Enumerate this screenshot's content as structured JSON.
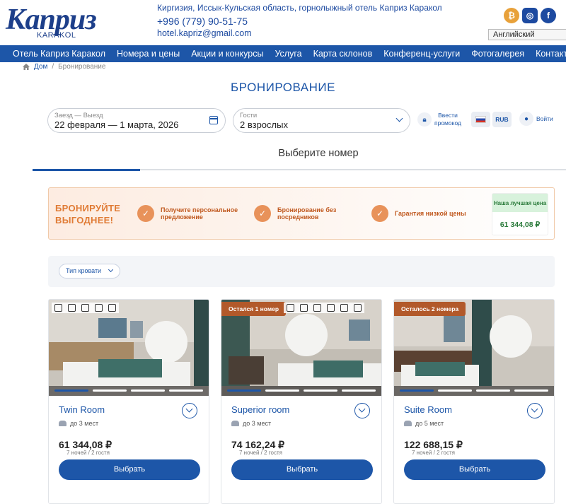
{
  "header": {
    "logo_text": "Каприз",
    "logo_sub": "KARAKOL",
    "address": "Киргизия, Иссык-Кульская область, горнолыжный отель Каприз Каракол",
    "phone": "+996 (779) 90-51-75",
    "email": "hotel.kapriz@gmail.com",
    "socials": [
      {
        "icon": "bitcoin-icon",
        "glyph": "₿"
      },
      {
        "icon": "instagram-icon",
        "glyph": "◎"
      },
      {
        "icon": "facebook-icon",
        "glyph": "f"
      }
    ],
    "language": "Английский"
  },
  "nav": [
    "Отель Каприз Каракол",
    "Номера и цены",
    "Акции и конкурсы",
    "Услуга",
    "Карта склонов",
    "Конференц-услуги",
    "Фотогалерея",
    "Контакты"
  ],
  "breadcrumb": {
    "home": "Дом",
    "current": "Бронирование"
  },
  "page_title": "БРОНИРОВАНИЕ",
  "search": {
    "dates_label": "Заезд — Выезд",
    "dates_value": "22 февраля — 1 марта, 2026",
    "guests_label": "Гости",
    "guests_value": "2 взрослых"
  },
  "account": {
    "promo_line1": "Ввести",
    "promo_line2": "промокод",
    "currency": "RUB",
    "login": "Войти"
  },
  "step_title": "Выберите номер",
  "promo": {
    "head_line1": "БРОНИРУЙТЕ",
    "head_line2": "ВЫГОДНЕЕ!",
    "perks": [
      {
        "line1": "Получите персональное",
        "line2": "предложение"
      },
      {
        "line1": "Бронирование без",
        "line2": "посредников"
      },
      {
        "line1": "Гарантия низкой цены",
        "line2": ""
      }
    ],
    "best_label": "Наша лучшая цена",
    "best_price": "61 344,08 ₽"
  },
  "filter": {
    "bed_type": "Тип кровати"
  },
  "rooms": [
    {
      "name": "Twin Room",
      "badge": "",
      "capacity": "до 3 мест",
      "price": "61 344,08 ₽",
      "nights": "7 ночей / 2 гостя",
      "button": "Выбрать"
    },
    {
      "name": "Superior room",
      "badge": "Остался 1 номер",
      "capacity": "до 3 мест",
      "price": "74 162,24 ₽",
      "nights": "7 ночей / 2 гостя",
      "button": "Выбрать"
    },
    {
      "name": "Suite Room",
      "badge": "Осталось 2 номера",
      "capacity": "до 5 мест",
      "price": "122 688,15 ₽",
      "nights": "7 ночей / 2 гостя",
      "button": "Выбрать"
    }
  ],
  "colors": {
    "brand": "#1d56a8",
    "promo_orange": "#e07b35",
    "badge": "#b2592a",
    "best_green": "#2a7a3a"
  }
}
